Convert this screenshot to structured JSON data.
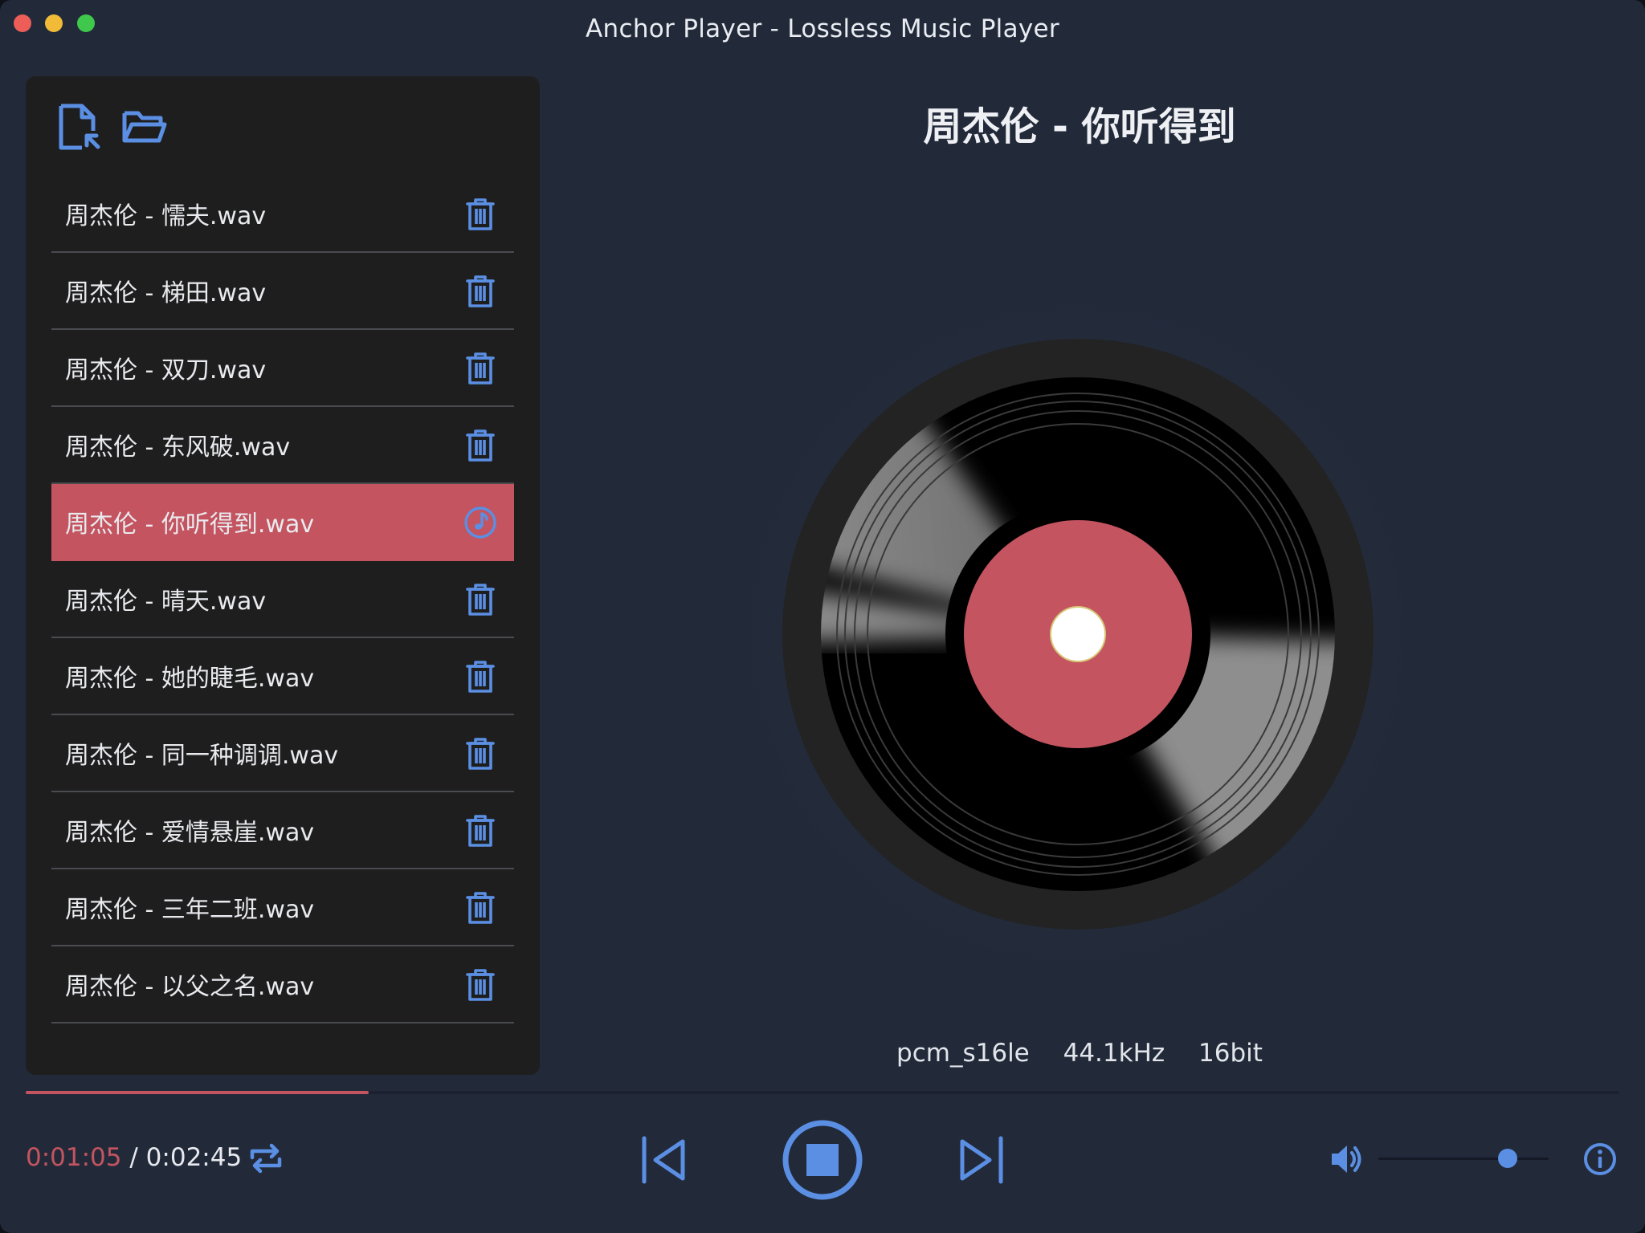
{
  "window": {
    "title": "Anchor Player - Lossless Music Player"
  },
  "toolbar": {
    "icons": [
      "add-file-icon",
      "open-folder-icon"
    ]
  },
  "playlist": {
    "items": [
      {
        "label": "周杰伦 - 懦夫.wav",
        "icon": "trash-icon"
      },
      {
        "label": "周杰伦 - 梯田.wav",
        "icon": "trash-icon"
      },
      {
        "label": "周杰伦 - 双刀.wav",
        "icon": "trash-icon"
      },
      {
        "label": "周杰伦 - 东风破.wav",
        "icon": "trash-icon"
      },
      {
        "label": "周杰伦 - 你听得到.wav",
        "icon": "music-note-icon",
        "active": true
      },
      {
        "label": "周杰伦 - 晴天.wav",
        "icon": "trash-icon"
      },
      {
        "label": "周杰伦 - 她的睫毛.wav",
        "icon": "trash-icon"
      },
      {
        "label": "周杰伦 - 同一种调调.wav",
        "icon": "trash-icon"
      },
      {
        "label": "周杰伦 - 爱情悬崖.wav",
        "icon": "trash-icon"
      },
      {
        "label": "周杰伦 - 三年二班.wav",
        "icon": "trash-icon"
      },
      {
        "label": "周杰伦 - 以父之名.wav",
        "icon": "trash-icon"
      }
    ]
  },
  "now_playing": {
    "title": "周杰伦 - 你听得到",
    "codec": "pcm_s16le",
    "sample_rate": "44.1kHz",
    "bit_depth": "16bit"
  },
  "playback": {
    "current_time": "0:01:05",
    "separator": " / ",
    "total_time": "0:02:45",
    "progress_fraction": 0.215,
    "volume_fraction": 0.76
  },
  "colors": {
    "accent_red": "#c35460",
    "accent_blue": "#5b8fe3",
    "background": "#222a3a",
    "sidebar": "#1e1e1f"
  }
}
